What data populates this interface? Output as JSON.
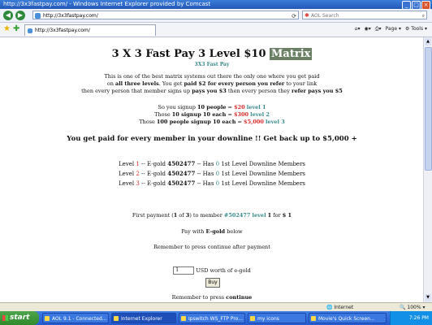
{
  "window": {
    "title": "http://3x3fastpay.com/ - Windows Internet Explorer provided by Comcast"
  },
  "toolbar": {
    "address": "http://3x3fastpay.com/",
    "search_placeholder": "AOL Search",
    "tab_label": "http://3x3fastpay.com/",
    "page_label": "Page",
    "tools_label": "Tools"
  },
  "page": {
    "title_main": "3 X 3 Fast Pay 3 Level $10",
    "title_highlight": "Matrix",
    "subtitle": "3X3 Fast Pay",
    "intro_1": "This is one of the best matrix systems out there the only one where you get paid",
    "intro_2a": "on",
    "intro_2b": "all three levels",
    "intro_2c": ". You get",
    "intro_2d": "paid $2 for every person you refer",
    "intro_2e": "to your link",
    "intro_3a": "then every person that member signs up",
    "intro_3b": "pays you $3",
    "intro_3c": "then every person they",
    "intro_3d": "refer pays you $5",
    "signup_1a": "So you signup",
    "signup_1b": "10 people",
    "signup_1c": "=",
    "signup_1d": "$20",
    "signup_1e": "level 1",
    "signup_2a": "Those",
    "signup_2b": "10 signup 10 each",
    "signup_2c": "=",
    "signup_2d": "$300",
    "signup_2e": "level 2",
    "signup_3a": "Those",
    "signup_3b": "100 people signup 10 each",
    "signup_3c": "=",
    "signup_3d": "$5,000",
    "signup_3e": "level 3",
    "paid_line": "You get paid for every member in your downline !! Get back up to $5,000 +",
    "levels": [
      {
        "pre": "Level",
        "num": "1",
        "mid": "-- E-gold",
        "id": "4502477",
        "dash": "-- Has",
        "count": "0",
        "post": "1st Level Downline Members"
      },
      {
        "pre": "Level",
        "num": "2",
        "mid": "-- E-gold",
        "id": "4502477",
        "dash": "-- Has",
        "count": "0",
        "post": "1st Level Downline Members"
      },
      {
        "pre": "Level",
        "num": "3",
        "mid": "-- E-gold",
        "id": "4502477",
        "dash": "-- Has",
        "count": "0",
        "post": "1st Level Downline Members"
      }
    ],
    "payment_a": "First payment (",
    "payment_b": "1",
    "payment_c": "of",
    "payment_d": "3",
    "payment_e": ") to member",
    "payment_f": "#502477",
    "payment_g": "level",
    "payment_h": "1",
    "payment_i": "for",
    "payment_j": "$ 1",
    "pay_with_a": "Pay with",
    "pay_with_b": "E-gold",
    "pay_with_c": "below",
    "remember_1": "Remember to press continue after payment",
    "amount_value": "1",
    "usd_label": "USD worth of e-gold",
    "buy_label": "Buy",
    "remember_2a": "Remember to press",
    "remember_2b": "continue"
  },
  "statusbar": {
    "zone": "Internet",
    "zoom": "100%"
  },
  "taskbar": {
    "start": "start",
    "tasks": [
      "AOL 9.1 - Connected...",
      "Internet Explorer",
      "Ipswitch WS_FTP Pro...",
      "my icons",
      "Movie's Quick Screen..."
    ],
    "clock": "7:26 PM"
  }
}
